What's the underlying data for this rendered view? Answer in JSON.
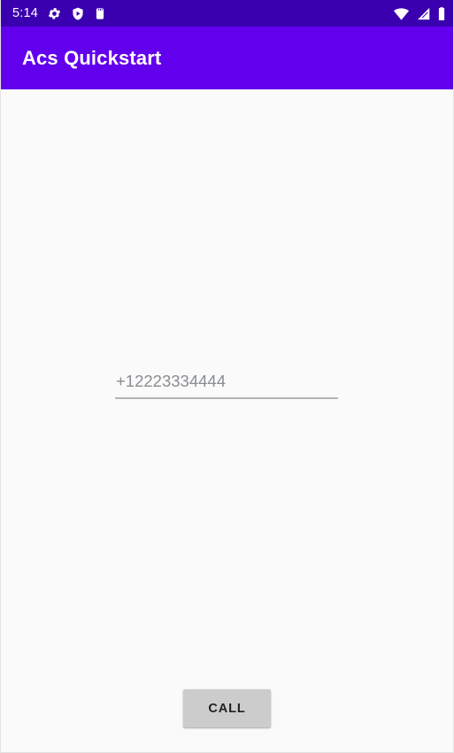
{
  "status_bar": {
    "clock": "5:14",
    "background_color": "#3a00b0",
    "icon_color": "#ffffff",
    "left_icons": [
      {
        "name": "settings-gear-icon",
        "label": "settings"
      },
      {
        "name": "play-protect-shield-icon",
        "label": "play protect"
      },
      {
        "name": "sim-card-icon",
        "label": "sim card"
      }
    ],
    "right_icons": [
      {
        "name": "wifi-icon",
        "label": "wifi"
      },
      {
        "name": "cellular-signal-icon",
        "label": "signal"
      },
      {
        "name": "battery-icon",
        "label": "battery full"
      }
    ]
  },
  "app_bar": {
    "title": "Acs Quickstart",
    "background_color": "#6200ee",
    "title_color": "#ffffff"
  },
  "content": {
    "background_color": "#fafafa",
    "phone_field": {
      "name": "phone-number-input",
      "value": "",
      "placeholder": "+12223334444",
      "placeholder_color": "#8a8d91",
      "underline_color": "#b0b3b8"
    },
    "call_button": {
      "label": "CALL",
      "background_color": "#cccccc",
      "text_color": "#212121"
    }
  }
}
